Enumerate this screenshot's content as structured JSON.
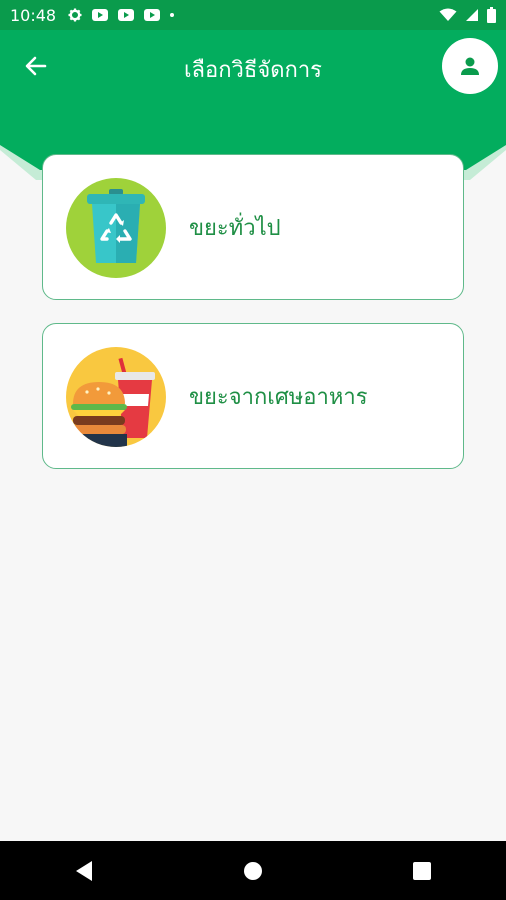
{
  "status_bar": {
    "time": "10:48"
  },
  "header": {
    "title": "เลือกวิธีจัดการ",
    "back_icon": "arrow-left-icon",
    "profile_icon": "person-icon"
  },
  "options": [
    {
      "label": "ขยะทั่วไป",
      "icon": "recycle-bin-icon"
    },
    {
      "label": "ขยะจากเศษอาหาร",
      "icon": "burger-drink-icon"
    }
  ],
  "nav": {
    "back_icon": "triangle-back-icon",
    "home_icon": "circle-home-icon",
    "recents_icon": "square-recents-icon"
  },
  "colors": {
    "primary": "#0a9b4c",
    "header_green": "#03ad5e",
    "label_green": "#1f8f45",
    "card_border": "#5fb98a",
    "background": "#f7f7f7"
  }
}
